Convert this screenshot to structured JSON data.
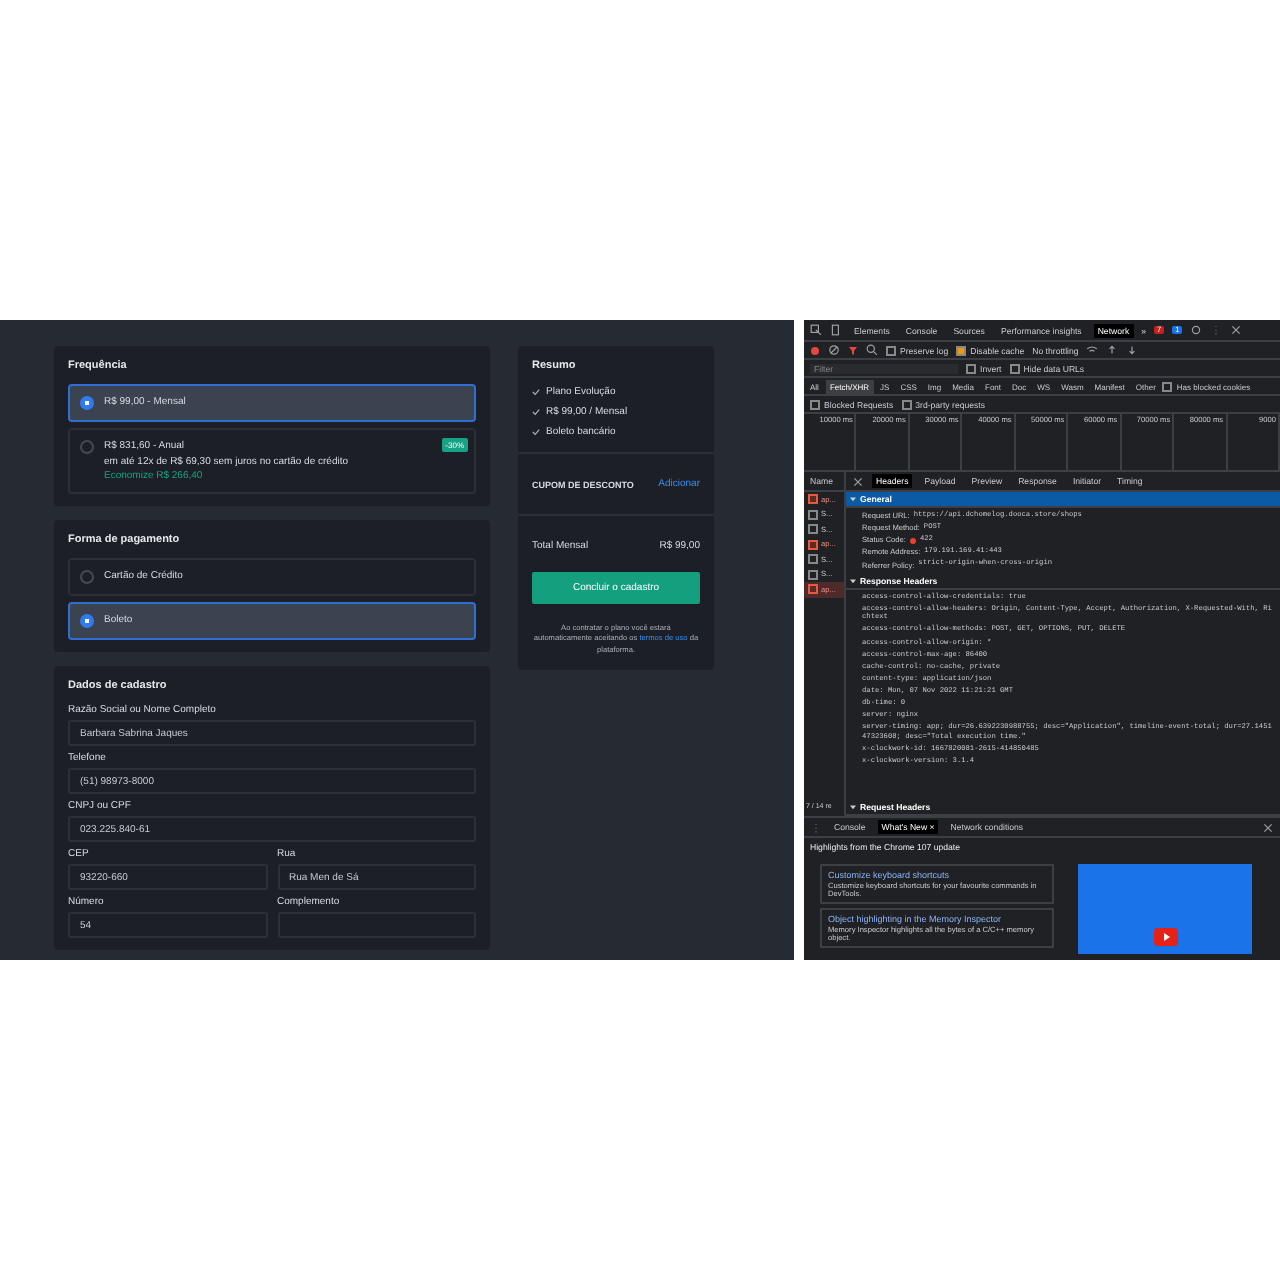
{
  "app": {
    "frequency": {
      "title": "Frequência",
      "options": [
        {
          "title": "R$ 99,00 - Mensal",
          "selected": true
        },
        {
          "title": "R$ 831,60 - Anual",
          "detail": "em até 12x de R$ 69,30 sem juros no cartão de crédito",
          "savings": "Economize R$ 266,40",
          "badge": "-30%",
          "selected": false
        }
      ]
    },
    "payment": {
      "title": "Forma de pagamento",
      "options": [
        {
          "label": "Cartão de Crédito",
          "selected": false
        },
        {
          "label": "Boleto",
          "selected": true
        }
      ]
    },
    "registration": {
      "title": "Dados de cadastro",
      "rows": [
        [
          {
            "label": "Razão Social ou Nome Completo",
            "value": "Barbara Sabrina Jaques"
          }
        ],
        [
          {
            "label": "Telefone",
            "value": "(51) 98973-8000"
          }
        ],
        [
          {
            "label": "CNPJ ou CPF",
            "value": "023.225.840-61"
          }
        ],
        [
          {
            "label": "CEP",
            "value": "93220-660"
          },
          {
            "label": "Rua",
            "value": "Rua Men de Sá"
          }
        ],
        [
          {
            "label": "Número",
            "value": "54"
          },
          {
            "label": "Complemento"
          }
        ]
      ]
    },
    "summary": {
      "title": "Resumo",
      "items": [
        "Plano Evolução",
        "R$ 99,00 / Mensal",
        "Boleto bancário"
      ],
      "coupon_label": "CUPOM DE DESCONTO",
      "coupon_action": "Adicionar",
      "total_label": "Total Mensal",
      "total_value": "R$ 99,00",
      "submit": "Concluir o cadastro",
      "note_before": "Ao contratar o plano você estará automaticamente aceitando os",
      "note_link": "termos de uso",
      "note_after": "da plataforma."
    }
  },
  "devtools": {
    "tabs": [
      {
        "label": "Elements",
        "selected": false
      },
      {
        "label": "Console",
        "selected": false
      },
      {
        "label": "Sources",
        "selected": false
      },
      {
        "label": "Performance insights",
        "selected": false
      },
      {
        "label": "Network",
        "selected": true
      }
    ],
    "more": "»",
    "error_count": "7",
    "info_count": "1",
    "toolbar": {
      "checks": [
        {
          "label": "Preserve log",
          "checked": false
        },
        {
          "label": "Disable cache",
          "checked": true
        }
      ],
      "throttling": "No throttling"
    },
    "filter": {
      "placeholder": "Filter",
      "checks": [
        {
          "label": "Invert",
          "checked": false
        },
        {
          "label": "Hide data URLs",
          "checked": false
        }
      ]
    },
    "types": [
      {
        "label": "All",
        "selected": false
      },
      {
        "label": "Fetch/XHR",
        "selected": true
      },
      {
        "label": "JS",
        "selected": false
      },
      {
        "label": "CSS",
        "selected": false
      },
      {
        "label": "Img",
        "selected": false
      },
      {
        "label": "Media",
        "selected": false
      },
      {
        "label": "Font",
        "selected": false
      },
      {
        "label": "Doc",
        "selected": false
      },
      {
        "label": "WS",
        "selected": false
      },
      {
        "label": "Wasm",
        "selected": false
      },
      {
        "label": "Manifest",
        "selected": false
      },
      {
        "label": "Other",
        "selected": false
      }
    ],
    "type_checks": [
      {
        "label": "Has blocked cookies",
        "checked": false
      }
    ],
    "extra_checks": [
      {
        "label": "Blocked Requests",
        "checked": false
      },
      {
        "label": "3rd-party requests",
        "checked": false
      }
    ],
    "timeline_ticks": [
      "10000 ms",
      "20000 ms",
      "30000 ms",
      "40000 ms",
      "50000 ms",
      "60000 ms",
      "70000 ms",
      "80000 ms",
      "9000"
    ],
    "name_header": "Name",
    "requests": [
      {
        "name": "ap...",
        "error": true,
        "selected": false
      },
      {
        "name": "S...",
        "error": false,
        "selected": false
      },
      {
        "name": "S...",
        "error": false,
        "selected": false
      },
      {
        "name": "ap...",
        "error": true,
        "selected": false
      },
      {
        "name": "S...",
        "error": false,
        "selected": false
      },
      {
        "name": "S...",
        "error": false,
        "selected": false
      },
      {
        "name": "ap...",
        "error": true,
        "selected": true
      }
    ],
    "requests_footer": "7 / 14 re",
    "detail_tabs": [
      {
        "label": "Headers",
        "selected": true
      },
      {
        "label": "Payload",
        "selected": false
      },
      {
        "label": "Preview",
        "selected": false
      },
      {
        "label": "Response",
        "selected": false
      },
      {
        "label": "Initiator",
        "selected": false
      },
      {
        "label": "Timing",
        "selected": false
      }
    ],
    "general": {
      "title": "General",
      "selected": true,
      "expanded": true,
      "rows": [
        {
          "key": "Request URL:",
          "value": "https://api.dchomelog.dooca.store/shops",
          "kind": "plain"
        },
        {
          "key": "Request Method:",
          "value": "POST",
          "kind": "plain"
        },
        {
          "key": "Status Code:",
          "value": "422",
          "kind": "status"
        },
        {
          "key": "Remote Address:",
          "value": "179.191.169.41:443",
          "kind": "plain"
        },
        {
          "key": "Referrer Policy:",
          "value": "strict-origin-when-cross-origin",
          "kind": "plain"
        }
      ]
    },
    "response_headers": {
      "title": "Response Headers",
      "selected": false,
      "expanded": true,
      "lines": [
        "access-control-allow-credentials: true",
        "access-control-allow-headers: Origin, Content-Type, Accept, Authorization, X-Requested-With, Richtext",
        "access-control-allow-methods: POST, GET, OPTIONS, PUT, DELETE",
        "access-control-allow-origin: *",
        "access-control-max-age: 86400",
        "cache-control: no-cache, private",
        "content-type: application/json",
        "date: Mon, 07 Nov 2022 11:21:21 GMT",
        "db-time: 0",
        "server: nginx",
        "server-timing: app; dur=26.6392230988755; desc=\"Application\", timeline-event-total; dur=27.145147323608; desc=\"Total execution time.\"",
        "x-clockwork-id: 1667820081-2615-414850485",
        "x-clockwork-version: 3.1.4"
      ]
    },
    "request_headers": {
      "title": "Request Headers",
      "selected": false,
      "expanded": true
    },
    "drawer": {
      "tabs": [
        {
          "label": "Console",
          "selected": false
        },
        {
          "label": "What's New",
          "selected": true,
          "close_mark": "×"
        },
        {
          "label": "Network conditions",
          "selected": false
        }
      ],
      "heading": "Highlights from the Chrome 107 update",
      "cards": [
        {
          "title": "Customize keyboard shortcuts",
          "description": "Customize keyboard shortcuts for your favourite commands in DevTools."
        },
        {
          "title": "Object highlighting in the Memory Inspector",
          "description": "Memory Inspector highlights all the bytes of a C/C++ memory object."
        }
      ]
    }
  }
}
